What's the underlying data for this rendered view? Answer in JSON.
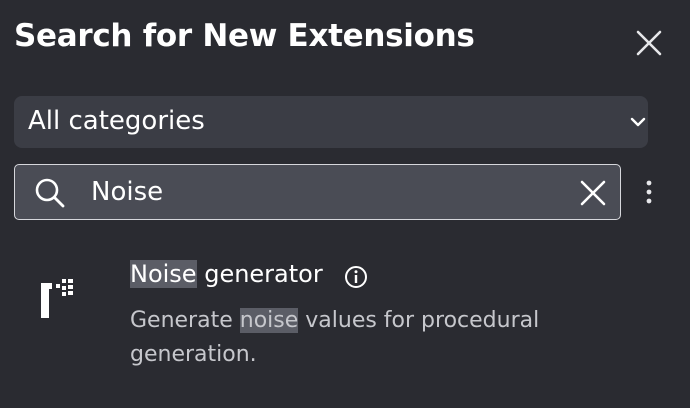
{
  "dialog": {
    "title": "Search for New Extensions"
  },
  "category_filter": {
    "selected": "All categories"
  },
  "search": {
    "value": "Noise"
  },
  "results": [
    {
      "name_highlight": "Noise",
      "name_rest": " generator",
      "desc_before": "Generate ",
      "desc_highlight": "noise",
      "desc_after": " values for procedural generation."
    }
  ],
  "icons": {
    "close": "close-icon",
    "dropdown": "chevron-down-icon",
    "search": "search-icon",
    "clear": "clear-icon",
    "more": "more-vertical-icon",
    "info": "info-icon",
    "extension": "noise-generator-icon"
  },
  "colors": {
    "background": "#2a2b31",
    "select_background": "#3b3d45",
    "input_background": "#4a4c55",
    "highlight": "#5b5d66",
    "text": "#ffffff",
    "muted_text": "#c6c7cc"
  }
}
